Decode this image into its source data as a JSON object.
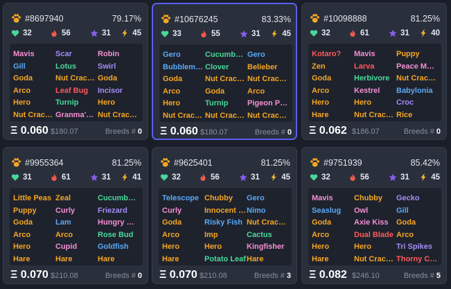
{
  "colors": {
    "orange": "#f5a623",
    "blue": "#5aa9f5",
    "pink": "#f48fd3",
    "purple": "#a38cf5",
    "green": "#48d89a",
    "red": "#ff5a5a",
    "card_bg": "#2a2f3c",
    "selected_border": "#5a5ff0"
  },
  "icons": {
    "paw": "paw-icon",
    "hp": "heart-icon",
    "speed": "flame-icon",
    "skill": "star-icon",
    "morale": "lightning-icon"
  },
  "cards": [
    {
      "id": "#8697940",
      "purity": "79.17%",
      "stats": {
        "hp": "32",
        "speed": "56",
        "skill": "31",
        "morale": "45"
      },
      "parts": [
        [
          {
            "t": "Mavis",
            "c": "pink"
          },
          {
            "t": "Gill",
            "c": "blue"
          },
          {
            "t": "Goda",
            "c": "orange"
          },
          {
            "t": "Arco",
            "c": "orange"
          },
          {
            "t": "Hero",
            "c": "orange"
          },
          {
            "t": "Nut Cracker",
            "c": "orange"
          }
        ],
        [
          {
            "t": "Scar",
            "c": "purple"
          },
          {
            "t": "Lotus",
            "c": "green"
          },
          {
            "t": "Nut Cracker",
            "c": "orange"
          },
          {
            "t": "Leaf Bug",
            "c": "red"
          },
          {
            "t": "Turnip",
            "c": "green"
          },
          {
            "t": "Granma's Fan",
            "c": "pink"
          }
        ],
        [
          {
            "t": "Robin",
            "c": "pink"
          },
          {
            "t": "Swirl",
            "c": "purple"
          },
          {
            "t": "Goda",
            "c": "orange"
          },
          {
            "t": "Incisor",
            "c": "purple"
          },
          {
            "t": "Hero",
            "c": "orange"
          },
          {
            "t": "Nut Cracker",
            "c": "orange"
          }
        ]
      ],
      "price_eth": "Ξ 0.060",
      "price_usd": "$180.07",
      "breeds_label": "Breeds #",
      "breeds": "0",
      "selected": false
    },
    {
      "id": "#10676245",
      "purity": "83.33%",
      "stats": {
        "hp": "33",
        "speed": "55",
        "skill": "31",
        "morale": "45"
      },
      "parts": [
        [
          {
            "t": "Gero",
            "c": "blue"
          },
          {
            "t": "Bubblemaker",
            "c": "blue"
          },
          {
            "t": "Goda",
            "c": "orange"
          },
          {
            "t": "Arco",
            "c": "orange"
          },
          {
            "t": "Hero",
            "c": "orange"
          },
          {
            "t": "Nut Cracker",
            "c": "orange"
          }
        ],
        [
          {
            "t": "Cucumber Slice",
            "c": "green"
          },
          {
            "t": "Clover",
            "c": "green"
          },
          {
            "t": "Nut Cracker",
            "c": "orange"
          },
          {
            "t": "Goda",
            "c": "orange"
          },
          {
            "t": "Turnip",
            "c": "green"
          },
          {
            "t": "Nut Cracker",
            "c": "orange"
          }
        ],
        [
          {
            "t": "Gero",
            "c": "blue"
          },
          {
            "t": "Belieber",
            "c": "orange"
          },
          {
            "t": "Nut Cracker",
            "c": "orange"
          },
          {
            "t": "Arco",
            "c": "orange"
          },
          {
            "t": "Pigeon Post",
            "c": "pink"
          },
          {
            "t": "Nut Cracker",
            "c": "orange"
          }
        ]
      ],
      "price_eth": "Ξ 0.060",
      "price_usd": "$180.07",
      "breeds_label": "Breeds #",
      "breeds": "0",
      "selected": true
    },
    {
      "id": "#10098888",
      "purity": "81.25%",
      "stats": {
        "hp": "32",
        "speed": "61",
        "skill": "31",
        "morale": "40"
      },
      "parts": [
        [
          {
            "t": "Kotaro?",
            "c": "red"
          },
          {
            "t": "Zen",
            "c": "orange"
          },
          {
            "t": "Goda",
            "c": "orange"
          },
          {
            "t": "Arco",
            "c": "orange"
          },
          {
            "t": "Hero",
            "c": "orange"
          },
          {
            "t": "Hare",
            "c": "orange"
          }
        ],
        [
          {
            "t": "Mavis",
            "c": "pink"
          },
          {
            "t": "Larva",
            "c": "red"
          },
          {
            "t": "Herbivore",
            "c": "green"
          },
          {
            "t": "Kestrel",
            "c": "pink"
          },
          {
            "t": "Hero",
            "c": "orange"
          },
          {
            "t": "Nut Cracker",
            "c": "orange"
          }
        ],
        [
          {
            "t": "Puppy",
            "c": "orange"
          },
          {
            "t": "Peace Maker",
            "c": "pink"
          },
          {
            "t": "Nut Cracker",
            "c": "orange"
          },
          {
            "t": "Babylonia",
            "c": "blue"
          },
          {
            "t": "Croc",
            "c": "purple"
          },
          {
            "t": "Rice",
            "c": "orange"
          }
        ]
      ],
      "price_eth": "Ξ 0.062",
      "price_usd": "$186.07",
      "breeds_label": "Breeds #",
      "breeds": "0",
      "selected": false
    },
    {
      "id": "#9955364",
      "purity": "81.25%",
      "stats": {
        "hp": "31",
        "speed": "61",
        "skill": "31",
        "morale": "41"
      },
      "parts": [
        [
          {
            "t": "Little Peas",
            "c": "orange"
          },
          {
            "t": "Puppy",
            "c": "orange"
          },
          {
            "t": "Goda",
            "c": "orange"
          },
          {
            "t": "Arco",
            "c": "orange"
          },
          {
            "t": "Hero",
            "c": "orange"
          },
          {
            "t": "Hare",
            "c": "orange"
          }
        ],
        [
          {
            "t": "Zeal",
            "c": "orange"
          },
          {
            "t": "Curly",
            "c": "pink"
          },
          {
            "t": "Lam",
            "c": "blue"
          },
          {
            "t": "Arco",
            "c": "orange"
          },
          {
            "t": "Cupid",
            "c": "pink"
          },
          {
            "t": "Hare",
            "c": "orange"
          }
        ],
        [
          {
            "t": "Cucumber Slice",
            "c": "green"
          },
          {
            "t": "Friezard",
            "c": "purple"
          },
          {
            "t": "Hungry Bird",
            "c": "pink"
          },
          {
            "t": "Rose Bud",
            "c": "green"
          },
          {
            "t": "Goldfish",
            "c": "blue"
          },
          {
            "t": "Hare",
            "c": "orange"
          }
        ]
      ],
      "price_eth": "Ξ 0.070",
      "price_usd": "$210.08",
      "breeds_label": "Breeds #",
      "breeds": "0",
      "selected": false
    },
    {
      "id": "#9625401",
      "purity": "81.25%",
      "stats": {
        "hp": "32",
        "speed": "56",
        "skill": "31",
        "morale": "45"
      },
      "parts": [
        [
          {
            "t": "Telescope",
            "c": "blue"
          },
          {
            "t": "Curly",
            "c": "pink"
          },
          {
            "t": "Goda",
            "c": "orange"
          },
          {
            "t": "Arco",
            "c": "orange"
          },
          {
            "t": "Hero",
            "c": "orange"
          },
          {
            "t": "Hare",
            "c": "orange"
          }
        ],
        [
          {
            "t": "Chubby",
            "c": "orange"
          },
          {
            "t": "Innocent Lamb",
            "c": "orange"
          },
          {
            "t": "Risky Fish",
            "c": "blue"
          },
          {
            "t": "Imp",
            "c": "orange"
          },
          {
            "t": "Hero",
            "c": "orange"
          },
          {
            "t": "Potato Leaf",
            "c": "green"
          }
        ],
        [
          {
            "t": "Gero",
            "c": "blue"
          },
          {
            "t": "Nimo",
            "c": "blue"
          },
          {
            "t": "Nut Cracker",
            "c": "orange"
          },
          {
            "t": "Cactus",
            "c": "green"
          },
          {
            "t": "Kingfisher",
            "c": "pink"
          },
          {
            "t": "Hare",
            "c": "orange"
          }
        ]
      ],
      "price_eth": "Ξ 0.070",
      "price_usd": "$210.08",
      "breeds_label": "Breeds #",
      "breeds": "3",
      "selected": false
    },
    {
      "id": "#9751939",
      "purity": "85.42%",
      "stats": {
        "hp": "32",
        "speed": "56",
        "skill": "31",
        "morale": "45"
      },
      "parts": [
        [
          {
            "t": "Mavis",
            "c": "pink"
          },
          {
            "t": "Seaslug",
            "c": "blue"
          },
          {
            "t": "Goda",
            "c": "orange"
          },
          {
            "t": "Arco",
            "c": "orange"
          },
          {
            "t": "Hero",
            "c": "orange"
          },
          {
            "t": "Hare",
            "c": "orange"
          }
        ],
        [
          {
            "t": "Chubby",
            "c": "orange"
          },
          {
            "t": "Owl",
            "c": "pink"
          },
          {
            "t": "Axie Kiss",
            "c": "pink"
          },
          {
            "t": "Dual Blade",
            "c": "red"
          },
          {
            "t": "Hero",
            "c": "orange"
          },
          {
            "t": "Nut Cracker",
            "c": "orange"
          }
        ],
        [
          {
            "t": "Gecko",
            "c": "purple"
          },
          {
            "t": "Gill",
            "c": "blue"
          },
          {
            "t": "Goda",
            "c": "orange"
          },
          {
            "t": "Arco",
            "c": "orange"
          },
          {
            "t": "Tri Spikes",
            "c": "purple"
          },
          {
            "t": "Thorny Caterpillar",
            "c": "red"
          }
        ]
      ],
      "price_eth": "Ξ 0.082",
      "price_usd": "$246.10",
      "breeds_label": "Breeds #",
      "breeds": "5",
      "selected": false
    }
  ]
}
